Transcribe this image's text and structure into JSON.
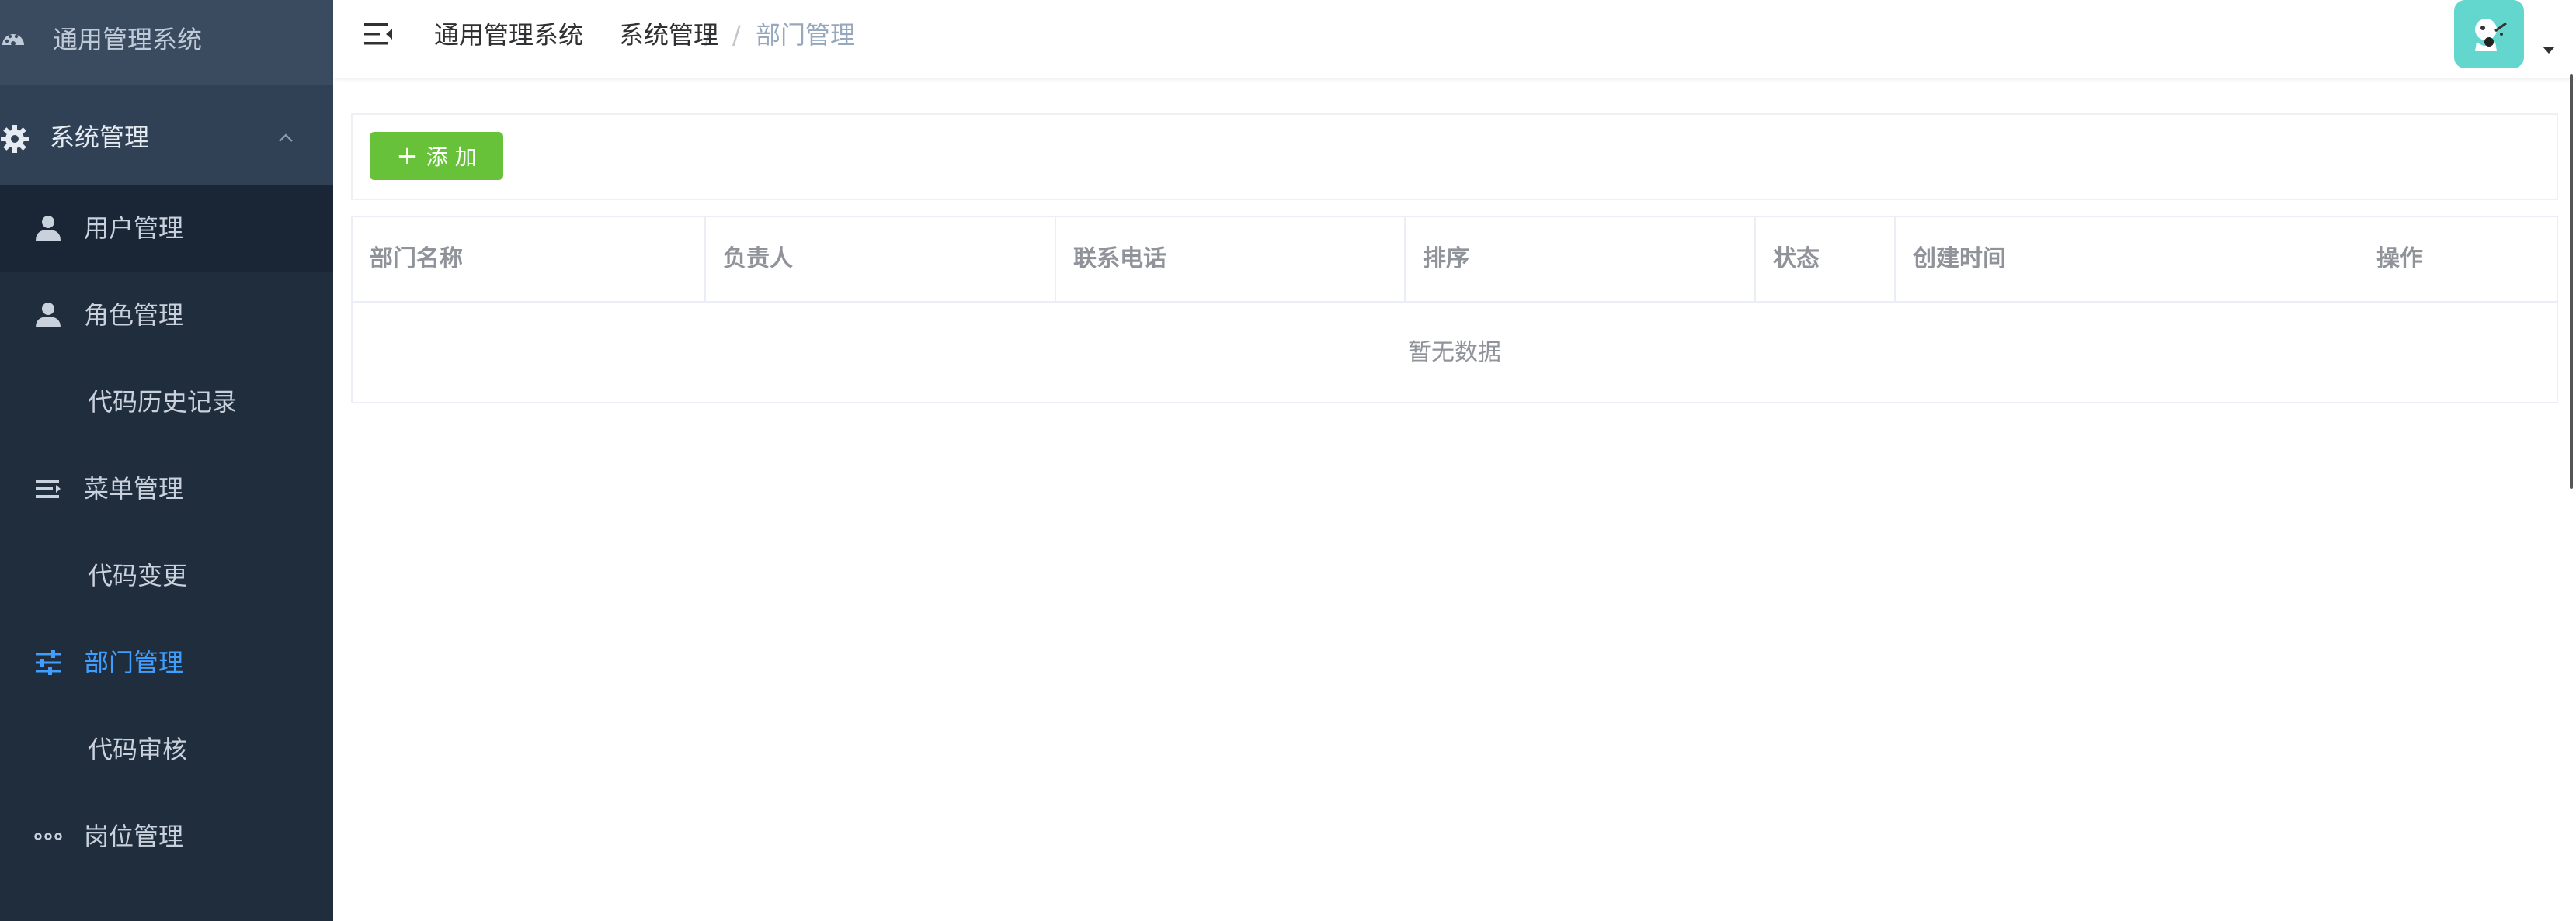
{
  "sidebar": {
    "brand": {
      "label": "通用管理系统",
      "icon": "dashboard-icon"
    },
    "group": {
      "label": "系统管理",
      "icon": "gear-icon",
      "chevron": "chevron-up-icon"
    },
    "items": [
      {
        "label": "用户管理",
        "icon": "user-icon"
      },
      {
        "label": "角色管理",
        "icon": "user-icon"
      },
      {
        "label": "代码历史记录",
        "icon": ""
      },
      {
        "label": "菜单管理",
        "icon": "menu-list-icon"
      },
      {
        "label": "代码变更",
        "icon": ""
      },
      {
        "label": "部门管理",
        "icon": "sliders-icon"
      },
      {
        "label": "代码审核",
        "icon": ""
      },
      {
        "label": "岗位管理",
        "icon": "dots-icon"
      },
      {
        "label": "",
        "icon": ""
      }
    ],
    "selected_color": "#409eff"
  },
  "topbar": {
    "toggle_icon": "hamburger-icon",
    "breadcrumb": [
      "通用管理系统",
      "系统管理",
      "部门管理"
    ],
    "separator": "/",
    "avatar_icon": "avatar-icon",
    "caret_icon": "caret-down-icon"
  },
  "toolbar": {
    "add_label": "添 加",
    "add_icon": "plus-icon",
    "add_color": "#67c23a"
  },
  "table": {
    "columns": [
      "部门名称",
      "负责人",
      "联系电话",
      "排序",
      "状态",
      "创建时间",
      "操作"
    ],
    "empty_text": "暂无数据"
  }
}
